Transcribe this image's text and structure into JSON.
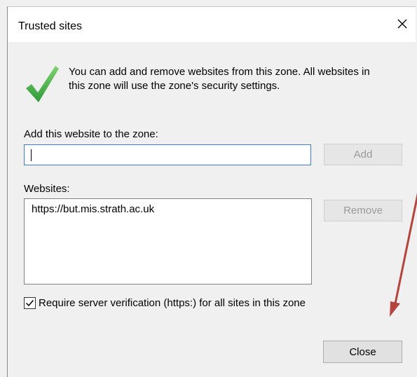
{
  "dialog": {
    "title": "Trusted sites",
    "info_line1": "You can add and remove websites from this zone. All websites in",
    "info_line2": "this zone will use the zone's security settings.",
    "add_label": "Add this website to the zone:",
    "add_input_value": "",
    "add_button": "Add",
    "websites_label": "Websites:",
    "websites": [
      "https://but.mis.strath.ac.uk"
    ],
    "remove_button": "Remove",
    "require_https_label": "Require server verification (https:) for all sites in this zone",
    "require_https_checked": true,
    "close_button": "Close"
  },
  "colors": {
    "annotation_arrow": "#b5443f",
    "checkmark": "#3fae44",
    "focus_border": "#3a7fd6"
  }
}
